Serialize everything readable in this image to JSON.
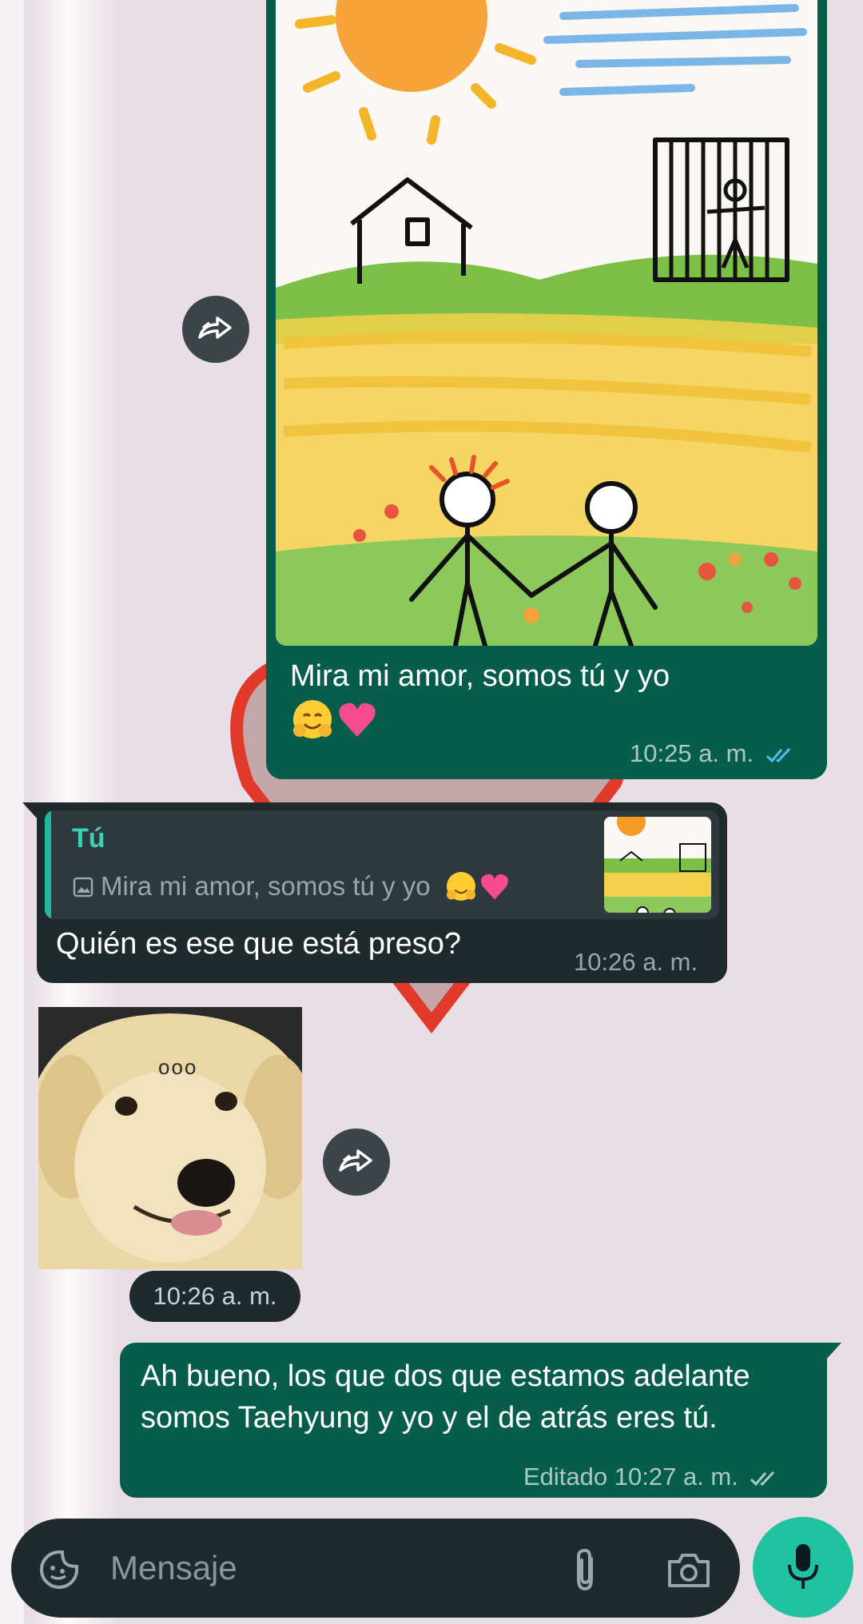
{
  "messages": {
    "m1": {
      "caption": "Mira mi amor, somos tú y yo",
      "time": "10:25 a. m.",
      "status": "read"
    },
    "m2": {
      "reply_author": "Tú",
      "reply_preview": "Mira mi amor, somos tú y yo",
      "text": "Quién es ese que está preso?",
      "time": "10:26 a. m."
    },
    "m3": {
      "sticker_dots": "ooo",
      "time": "10:26 a. m."
    },
    "m4": {
      "text": "Ah bueno, los que dos que estamos adelante somos Taehyung y yo y el de atrás eres tú.",
      "edited": "Editado",
      "time": "10:27 a. m.",
      "status": "delivered"
    }
  },
  "composer": {
    "placeholder": "Mensaje"
  },
  "colors": {
    "outgoing": "#075d4c",
    "incoming": "#1f2a2f",
    "accent": "#21c29f",
    "read_ticks": "#53bdeb"
  },
  "icons": [
    "forward-icon",
    "emoji-sticker-icon",
    "attach-icon",
    "camera-icon",
    "mic-icon",
    "image-icon",
    "double-check-icon"
  ]
}
